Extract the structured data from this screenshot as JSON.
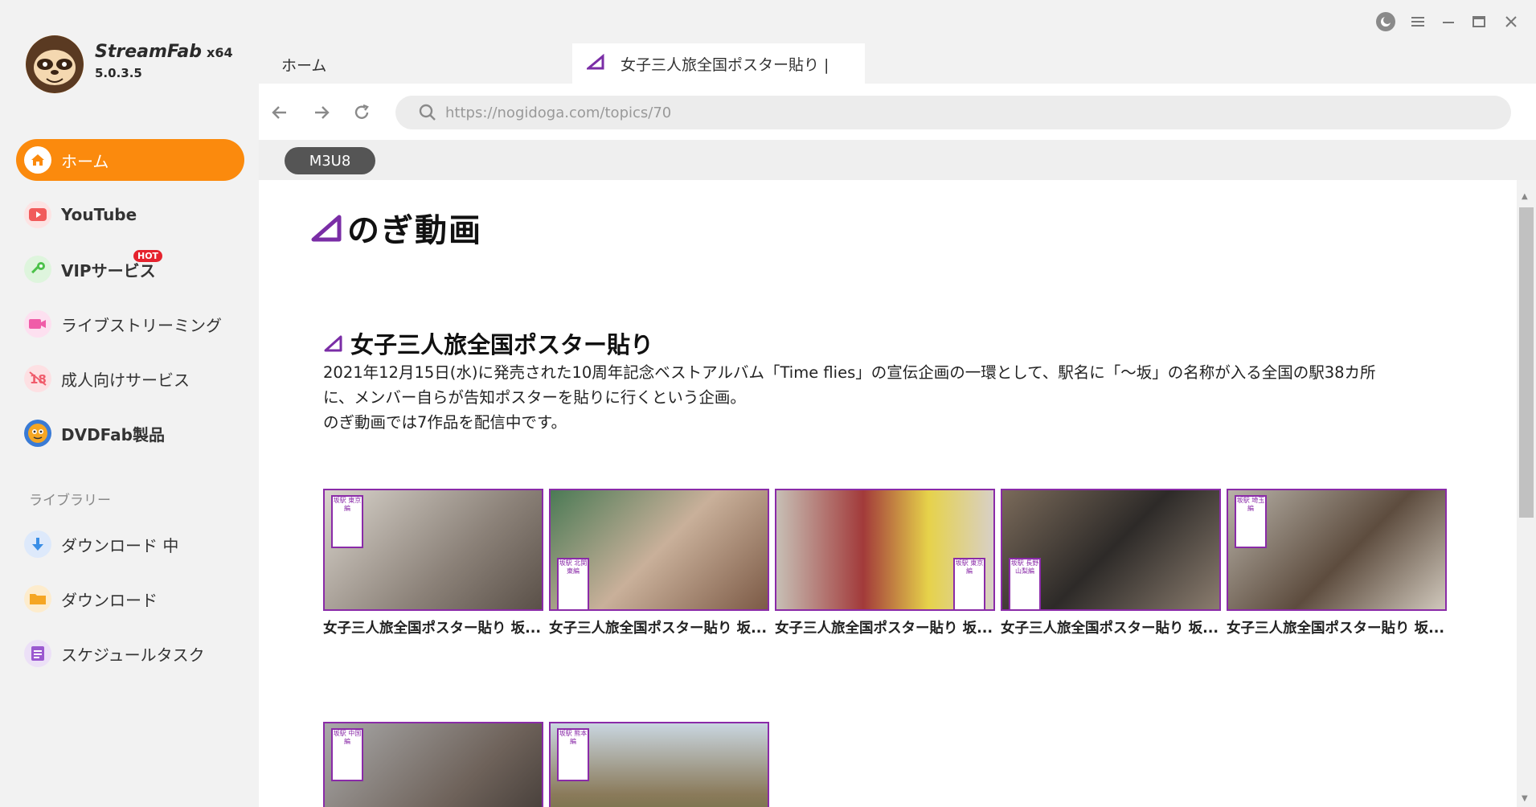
{
  "app": {
    "name": "StreamFab",
    "arch": "x64",
    "version": "5.0.3.5"
  },
  "window_controls": [
    "theme",
    "menu",
    "minimize",
    "maximize",
    "close"
  ],
  "sidebar": {
    "items": [
      {
        "label": "ホーム",
        "icon": "home-icon",
        "active": true,
        "color": "#fb8a0d"
      },
      {
        "label": "YouTube",
        "icon": "youtube-icon",
        "color": "#f15b5b"
      },
      {
        "label": "VIPサービス",
        "icon": "key-icon",
        "badge": "HOT",
        "color": "#4cc24a"
      },
      {
        "label": "ライブストリーミング",
        "icon": "video-camera-icon",
        "color": "#f05ca8"
      },
      {
        "label": "成人向けサービス",
        "icon": "adult-18-icon",
        "color": "#f05c6c"
      },
      {
        "label": "DVDFab製品",
        "icon": "dvdfab-icon",
        "color": "#3a7bd5"
      }
    ],
    "library_header": "ライブラリー",
    "library_items": [
      {
        "label": "ダウンロード 中",
        "icon": "download-arrow-icon",
        "color": "#3a8ee6"
      },
      {
        "label": "ダウンロード",
        "icon": "folder-icon",
        "color": "#f5a623"
      },
      {
        "label": "スケジュールタスク",
        "icon": "schedule-list-icon",
        "color": "#9b59d0"
      }
    ]
  },
  "tabs": [
    {
      "label": "ホーム"
    },
    {
      "label": "女子三人旅全国ポスター貼り |"
    }
  ],
  "browser": {
    "url": "https://nogidoga.com/topics/70",
    "m3u8_label": "M3U8"
  },
  "page": {
    "site_logo": "のぎ動画",
    "title": "女子三人旅全国ポスター貼り",
    "description_lines": [
      "2021年12月15日(水)に発売された10周年記念ベストアルバム「Time flies」の宣伝企画の一環として、駅名に「〜坂」の名称が入る全国の駅38カ所",
      "に、メンバー自らが告知ポスターを貼りに行くという企画。",
      "のぎ動画では7作品を配信中です。"
    ],
    "videos": [
      {
        "caption": "女子三人旅全国ポスター貼り 坂...",
        "badge": "坂駅 東京編"
      },
      {
        "caption": "女子三人旅全国ポスター貼り 坂...",
        "badge": "坂駅 北関東編"
      },
      {
        "caption": "女子三人旅全国ポスター貼り 坂...",
        "badge": "坂駅 東京編"
      },
      {
        "caption": "女子三人旅全国ポスター貼り 坂...",
        "badge": "坂駅 長野山梨編"
      },
      {
        "caption": "女子三人旅全国ポスター貼り 坂...",
        "badge": "坂駅 埼玉編"
      },
      {
        "caption": "",
        "badge": "坂駅 中国編"
      },
      {
        "caption": "",
        "badge": "坂駅 熊本編"
      }
    ]
  }
}
